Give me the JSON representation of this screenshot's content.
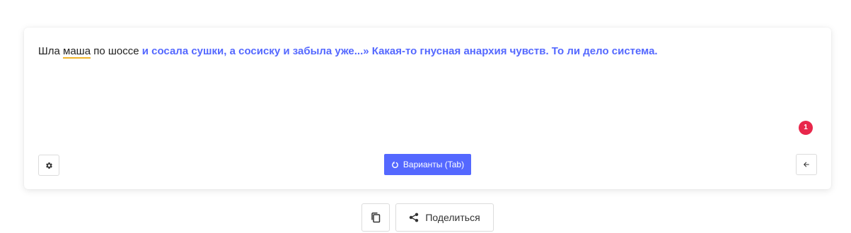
{
  "editor": {
    "text_before_flag": "Шла ",
    "flagged_word": "маша",
    "text_after_flag": " по шоссе ",
    "suggestion_text": "и сосала сушки, а сосиску и забыла уже...» Какая-то гнусная анархия чувств. То ли дело система."
  },
  "badge": {
    "count": "1",
    "color": "#e8274b"
  },
  "toolbar": {
    "settings_icon": "gear-icon",
    "variants_label": "Варианты (Tab)",
    "variants_icon": "refresh-icon",
    "back_icon": "arrow-left-icon"
  },
  "actions": {
    "copy_icon": "copy-icon",
    "share_label": "Поделиться",
    "share_icon": "share-icon"
  },
  "colors": {
    "accent": "#5468ff",
    "flag_underline": "#f0b429"
  }
}
